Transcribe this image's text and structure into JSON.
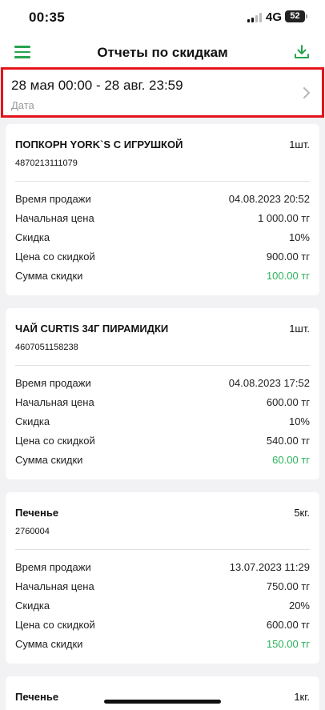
{
  "status_bar": {
    "time": "00:35",
    "network": "4G",
    "battery": "52"
  },
  "header": {
    "title": "Отчеты по скидкам",
    "menu_icon": "hamburger-menu-icon",
    "download_icon": "download-icon"
  },
  "filter": {
    "date_range": "28 мая 00:00 - 28 авг. 23:59",
    "label": "Дата"
  },
  "row_labels": {
    "sale_time": "Время продажи",
    "original_price": "Начальная цена",
    "discount": "Скидка",
    "discounted_price": "Цена со скидкой",
    "discount_sum": "Сумма скидки"
  },
  "items": [
    {
      "name": "ПОПКОРН YORK`S С ИГРУШКОЙ",
      "qty": "1шт.",
      "code": "4870213111079",
      "sale_time": "04.08.2023 20:52",
      "original_price": "1 000.00 тг",
      "discount": "10%",
      "discounted_price": "900.00 тг",
      "discount_sum": "100.00 тг"
    },
    {
      "name": "ЧАЙ CURTIS 34Г ПИРАМИДКИ",
      "qty": "1шт.",
      "code": "4607051158238",
      "sale_time": "04.08.2023 17:52",
      "original_price": "600.00 тг",
      "discount": "10%",
      "discounted_price": "540.00 тг",
      "discount_sum": "60.00 тг"
    },
    {
      "name": "Печенье",
      "qty": "5кг.",
      "code": "2760004",
      "sale_time": "13.07.2023 11:29",
      "original_price": "750.00 тг",
      "discount": "20%",
      "discounted_price": "600.00 тг",
      "discount_sum": "150.00 тг"
    },
    {
      "name": "Печенье",
      "qty": "1кг."
    }
  ],
  "colors": {
    "accent_green": "#27a350",
    "discount_green": "#2bb45a",
    "highlight_red": "#e4141b"
  }
}
